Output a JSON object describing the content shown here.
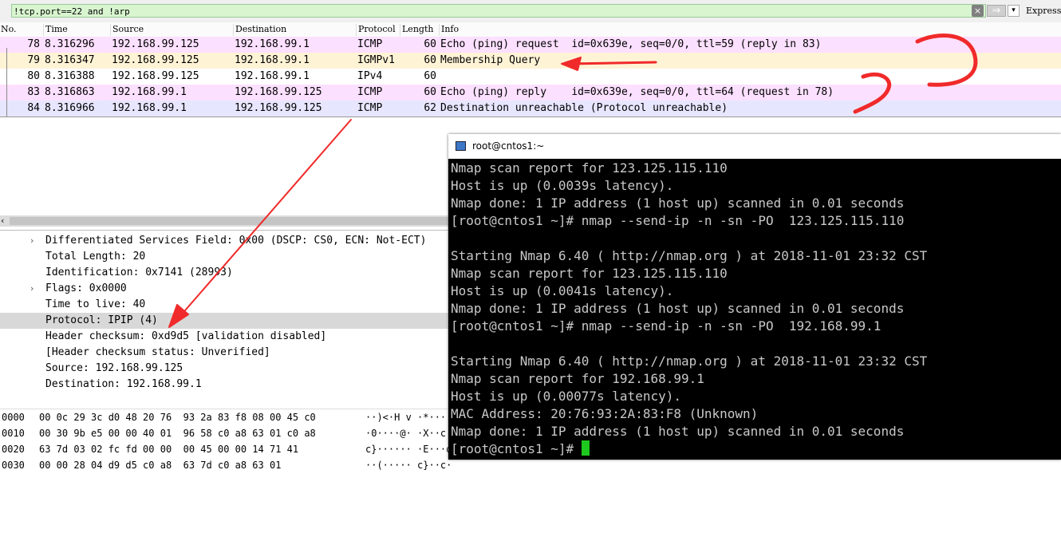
{
  "filter": {
    "value": "!tcp.port==22 and !arp",
    "clear_icon": "×",
    "apply_icon": "⇒",
    "dropdown_icon": "▾",
    "expression_label": "Express"
  },
  "packet_list": {
    "columns": [
      "No.",
      "Time",
      "Source",
      "Destination",
      "Protocol",
      "Length",
      "Info"
    ],
    "rows": [
      {
        "no": "78",
        "time": "8.316296",
        "src": "192.168.99.125",
        "dst": "192.168.99.1",
        "proto": "ICMP",
        "len": "60",
        "info": "Echo (ping) request  id=0x639e, seq=0/0, ttl=59 (reply in 83)",
        "bg": "#fce0ff"
      },
      {
        "no": "79",
        "time": "8.316347",
        "src": "192.168.99.125",
        "dst": "192.168.99.1",
        "proto": "IGMPv1",
        "len": "60",
        "info": "Membership Query",
        "bg": "#fff3d6"
      },
      {
        "no": "80",
        "time": "8.316388",
        "src": "192.168.99.125",
        "dst": "192.168.99.1",
        "proto": "IPv4",
        "len": "60",
        "info": "",
        "bg": "#ffffff"
      },
      {
        "no": "83",
        "time": "8.316863",
        "src": "192.168.99.1",
        "dst": "192.168.99.125",
        "proto": "ICMP",
        "len": "60",
        "info": "Echo (ping) reply    id=0x639e, seq=0/0, ttl=64 (request in 78)",
        "bg": "#fce0ff"
      },
      {
        "no": "84",
        "time": "8.316966",
        "src": "192.168.99.1",
        "dst": "192.168.99.125",
        "proto": "ICMP",
        "len": "62",
        "info": "Destination unreachable (Protocol unreachable)",
        "bg": "#e7e6ff"
      }
    ]
  },
  "details": {
    "expand_icon": "›",
    "lines": [
      "Differentiated Services Field: 0x00 (DSCP: CS0, ECN: Not-ECT)",
      "Total Length: 20",
      "Identification: 0x7141 (28993)",
      "Flags: 0x0000",
      "Time to live: 40",
      "Protocol: IPIP (4)",
      "Header checksum: 0xd9d5 [validation disabled]",
      "[Header checksum status: Unverified]",
      "Source: 192.168.99.125",
      "Destination: 192.168.99.1"
    ]
  },
  "bytes": {
    "rows": [
      {
        "offset": "0000",
        "hex": "00 0c 29 3c d0 48 20 76  93 2a 83 f8 08 00 45 c0",
        "ascii": "··)<·H v ·*····E·"
      },
      {
        "offset": "0010",
        "hex": "00 30 9b e5 00 00 40 01  96 58 c0 a8 63 01 c0 a8",
        "ascii": "·0····@· ·X··c···"
      },
      {
        "offset": "0020",
        "hex": "63 7d 03 02 fc fd 00 00  00 45 00 00 14 71 41",
        "ascii": "c}······ ·E···qA"
      },
      {
        "offset": "0030",
        "hex": "00 00 28 04 d9 d5 c0 a8  63 7d c0 a8 63 01",
        "ascii": "··(····· c}··c·"
      }
    ]
  },
  "scroll": {
    "left_arrow": "‹"
  },
  "terminal": {
    "title": "root@cntos1:~",
    "lines": [
      "Nmap scan report for 123.125.115.110",
      "Host is up (0.0039s latency).",
      "Nmap done: 1 IP address (1 host up) scanned in 0.01 seconds",
      "[root@cntos1 ~]# nmap --send-ip -n -sn -PO  123.125.115.110",
      "",
      "Starting Nmap 6.40 ( http://nmap.org ) at 2018-11-01 23:32 CST",
      "Nmap scan report for 123.125.115.110",
      "Host is up (0.0041s latency).",
      "Nmap done: 1 IP address (1 host up) scanned in 0.01 seconds",
      "[root@cntos1 ~]# nmap --send-ip -n -sn -PO  192.168.99.1",
      "",
      "Starting Nmap 6.40 ( http://nmap.org ) at 2018-11-01 23:32 CST",
      "Nmap scan report for 192.168.99.1",
      "Host is up (0.00077s latency).",
      "MAC Address: 20:76:93:2A:83:F8 (Unknown)",
      "Nmap done: 1 IP address (1 host up) scanned in 0.01 seconds"
    ],
    "prompt": "[root@cntos1 ~]# "
  },
  "annotation_color": "#f02a2a"
}
